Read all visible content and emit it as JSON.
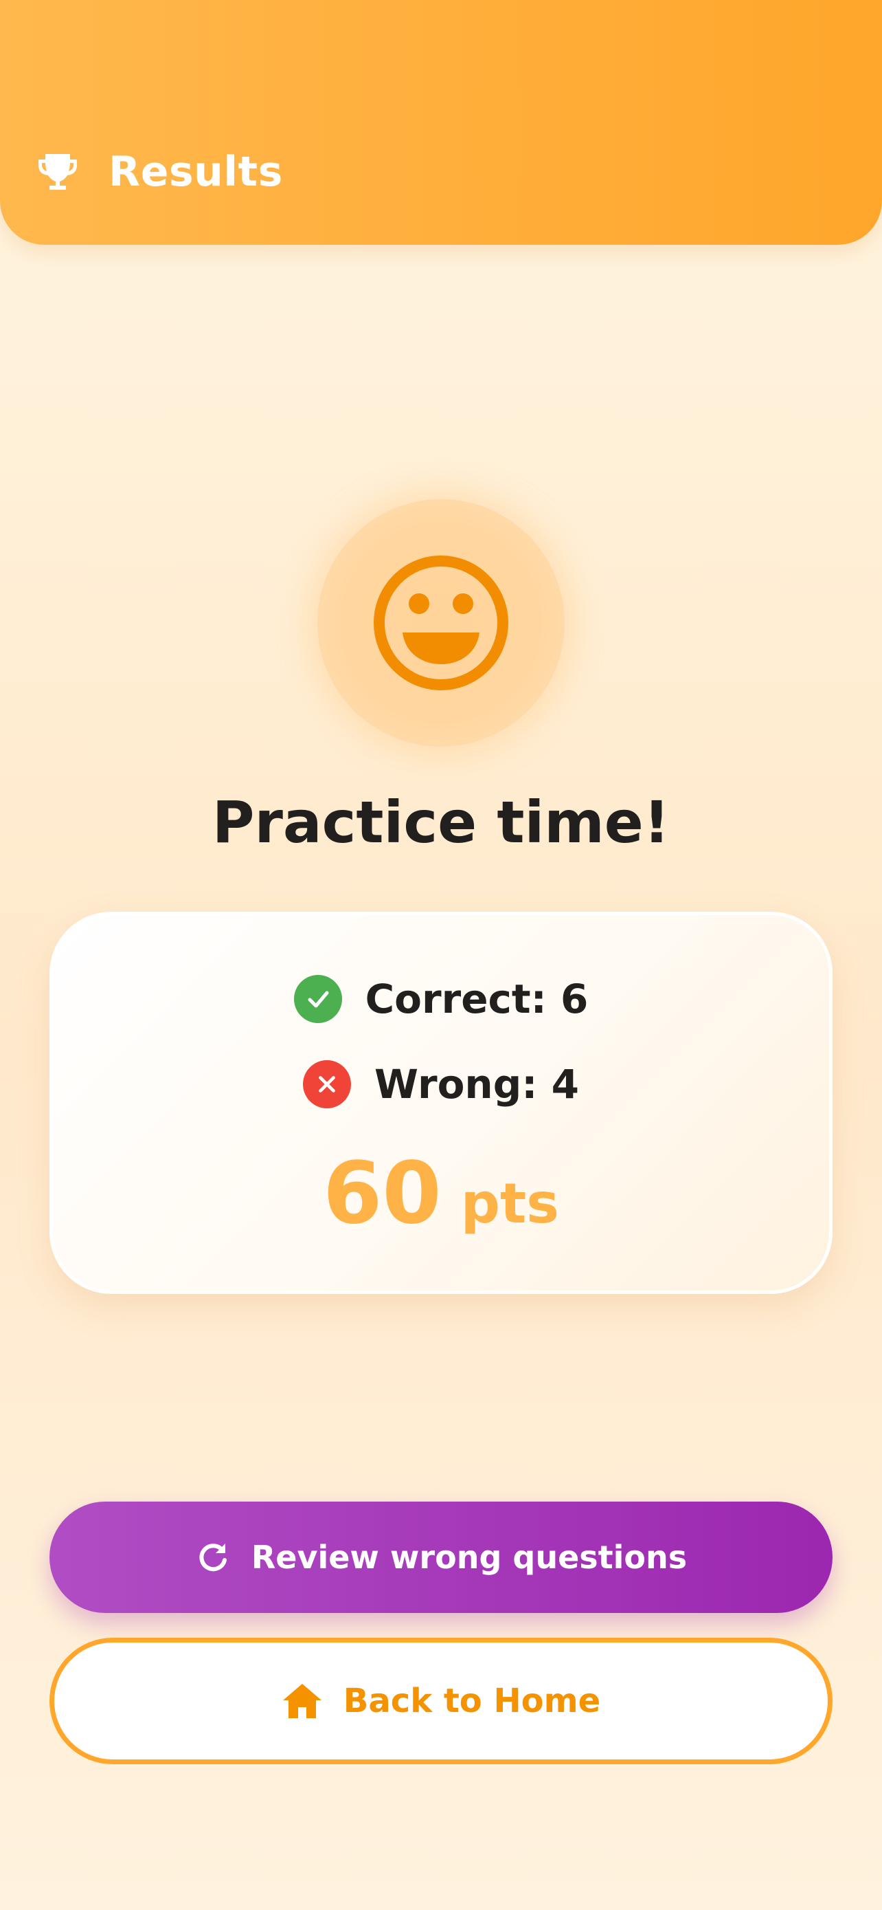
{
  "header": {
    "title": "Results",
    "icon": "trophy-icon",
    "background": "#FFA62B"
  },
  "result": {
    "emoji_icon": "happy-face-icon",
    "headline": "Practice time!"
  },
  "stats": {
    "correct_label": "Correct: 6",
    "correct_icon": "check-circle-icon",
    "wrong_label": "Wrong: 4",
    "wrong_icon": "x-circle-icon",
    "score_value": "60",
    "score_unit": "pts"
  },
  "actions": {
    "review_label": "Review wrong questions",
    "review_icon": "refresh-icon",
    "home_label": "Back to Home",
    "home_icon": "home-icon"
  },
  "colors": {
    "accent_orange": "#FFA62B",
    "purple": "#9C27B0",
    "correct_green": "#4CAF50",
    "wrong_red": "#F04438",
    "score_orange": "#FFB347"
  }
}
